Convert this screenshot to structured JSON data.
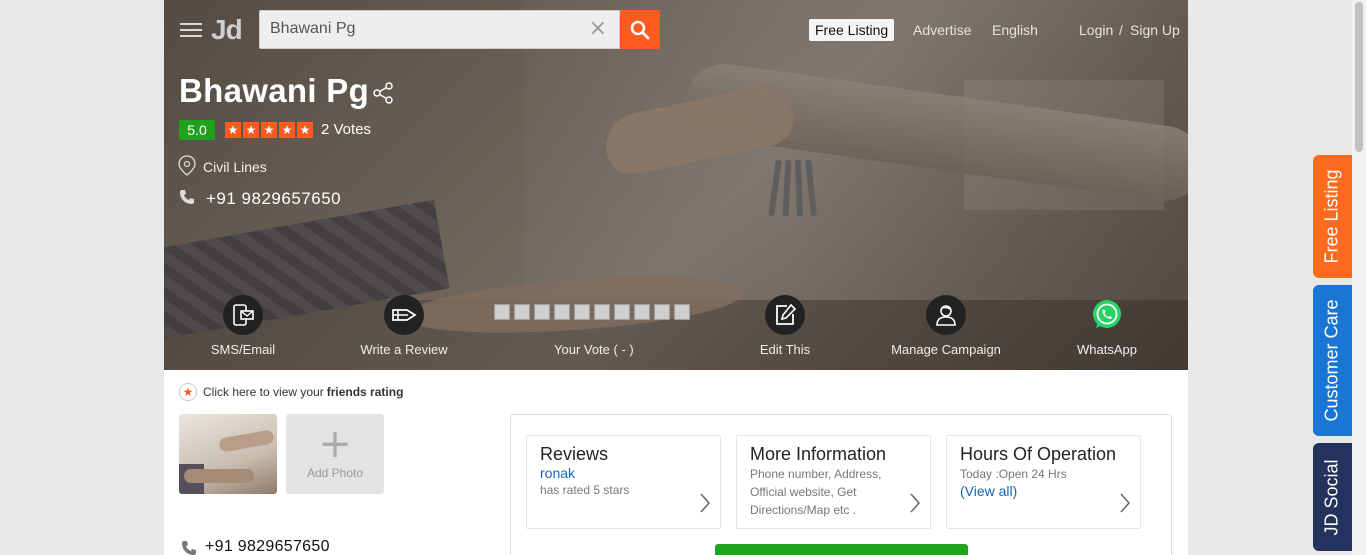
{
  "header": {
    "logo": "Jd",
    "search_value": "Bhawani Pg",
    "search_clear": "×",
    "free_listing": "Free Listing",
    "advertise": "Advertise",
    "language": "English",
    "login": "Login",
    "login_sep": "/",
    "signup": "Sign Up"
  },
  "business": {
    "name": "Bhawani Pg",
    "rating": "5.0",
    "stars": 5,
    "votes": "2 Votes",
    "location": "Civil Lines",
    "phone": "+91 9829657650"
  },
  "actions": {
    "sms": "SMS/Email",
    "review": "Write a Review",
    "vote": "Your Vote ( - )",
    "edit": "Edit This",
    "campaign": "Manage Campaign",
    "whatsapp": "WhatsApp"
  },
  "friends": {
    "prefix": "Click here to view your",
    "bold": "friends rating"
  },
  "photos": {
    "add_label": "Add Photo"
  },
  "phone_below": "+91 9829657650",
  "cards": {
    "reviews": {
      "title": "Reviews",
      "user": "ronak",
      "text": "has rated 5 stars"
    },
    "more_info": {
      "title": "More Information",
      "l1": "Phone number, Address,",
      "l2": "Official website, Get",
      "l3": "Directions/Map etc ."
    },
    "hours": {
      "title": "Hours Of Operation",
      "today": "Today :Open 24 Hrs",
      "view_all": "(View all)"
    }
  },
  "side_tabs": {
    "free_listing": "Free Listing",
    "customer_care": "Customer Care",
    "jd_social": "JD Social"
  },
  "colors": {
    "accent": "#ff5a1f",
    "rating_green": "#1fa31f",
    "link_blue": "#1565c0",
    "customer_care_blue": "#1976d2",
    "jd_social_navy": "#23335e"
  }
}
